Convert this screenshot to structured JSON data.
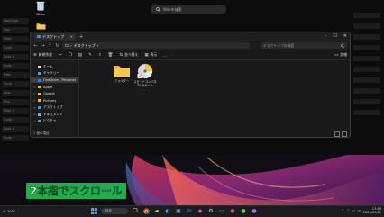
{
  "desktop": {
    "icons": [
      {
        "label": "Ditto",
        "icon": "recycle-bin-icon"
      },
      {
        "label": "",
        "icon": "folder-icon"
      }
    ]
  },
  "background_window": {
    "search_placeholder": "Webを検索",
    "side_items": [
      "Webhook",
      "Tool",
      "Data",
      "Code",
      "Data 2",
      "Code 2",
      "Files",
      "Zone",
      "Lists",
      "Pins",
      "Data 3",
      "Code 3",
      "Data 4",
      "Code 4",
      "Data 5",
      "Code 5"
    ]
  },
  "explorer": {
    "tab_title": "デスクトップ",
    "address_path": "デスクトップ",
    "search_placeholder": "デスクトップの検索",
    "toolbar": {
      "new": "新規作成",
      "sort": "並べ替え",
      "view": "表示",
      "more": "...",
      "details": "詳細"
    },
    "nav_items": [
      {
        "label": "ホーム",
        "icon": "home-icon",
        "chevron": "",
        "selected": false
      },
      {
        "label": "ギャラリー",
        "icon": "gallery-icon",
        "chevron": "",
        "selected": false
      },
      {
        "label": "OneDrive - Personal",
        "icon": "onedrive-icon",
        "chevron": ">",
        "selected": true
      },
      {
        "label": "Apple",
        "icon": "folder-icon",
        "chevron": ">",
        "selected": false
      },
      {
        "label": "Google",
        "icon": "folder-icon",
        "chevron": ">",
        "selected": false
      },
      {
        "label": "Pictures",
        "icon": "folder-icon",
        "chevron": ">",
        "selected": false
      },
      {
        "label": "デスクトップ",
        "icon": "desktop-folder-icon",
        "chevron": ">",
        "selected": false
      },
      {
        "label": "ドキュメント",
        "icon": "documents-icon",
        "chevron": ">",
        "selected": false
      },
      {
        "label": "ピクチャ",
        "icon": "pictures-icon",
        "chevron": ">",
        "selected": false
      }
    ],
    "files": [
      {
        "name": "フォルダー",
        "type": "folder"
      },
      {
        "name": "スピードコンパネ\nTV-サポート",
        "type": "app"
      }
    ],
    "status": "2 個の項目"
  },
  "caption": {
    "text": "2本指でスクロール"
  },
  "taskbar": {
    "weather_temp": "20°C",
    "search_placeholder": "検索",
    "clock_time": "17:40",
    "clock_date": "2024/09/01"
  },
  "colors": {
    "caption_bg": "#1fae4d",
    "folder_yellow": "#e8b73a",
    "selected_nav": "#3a3a3a"
  }
}
